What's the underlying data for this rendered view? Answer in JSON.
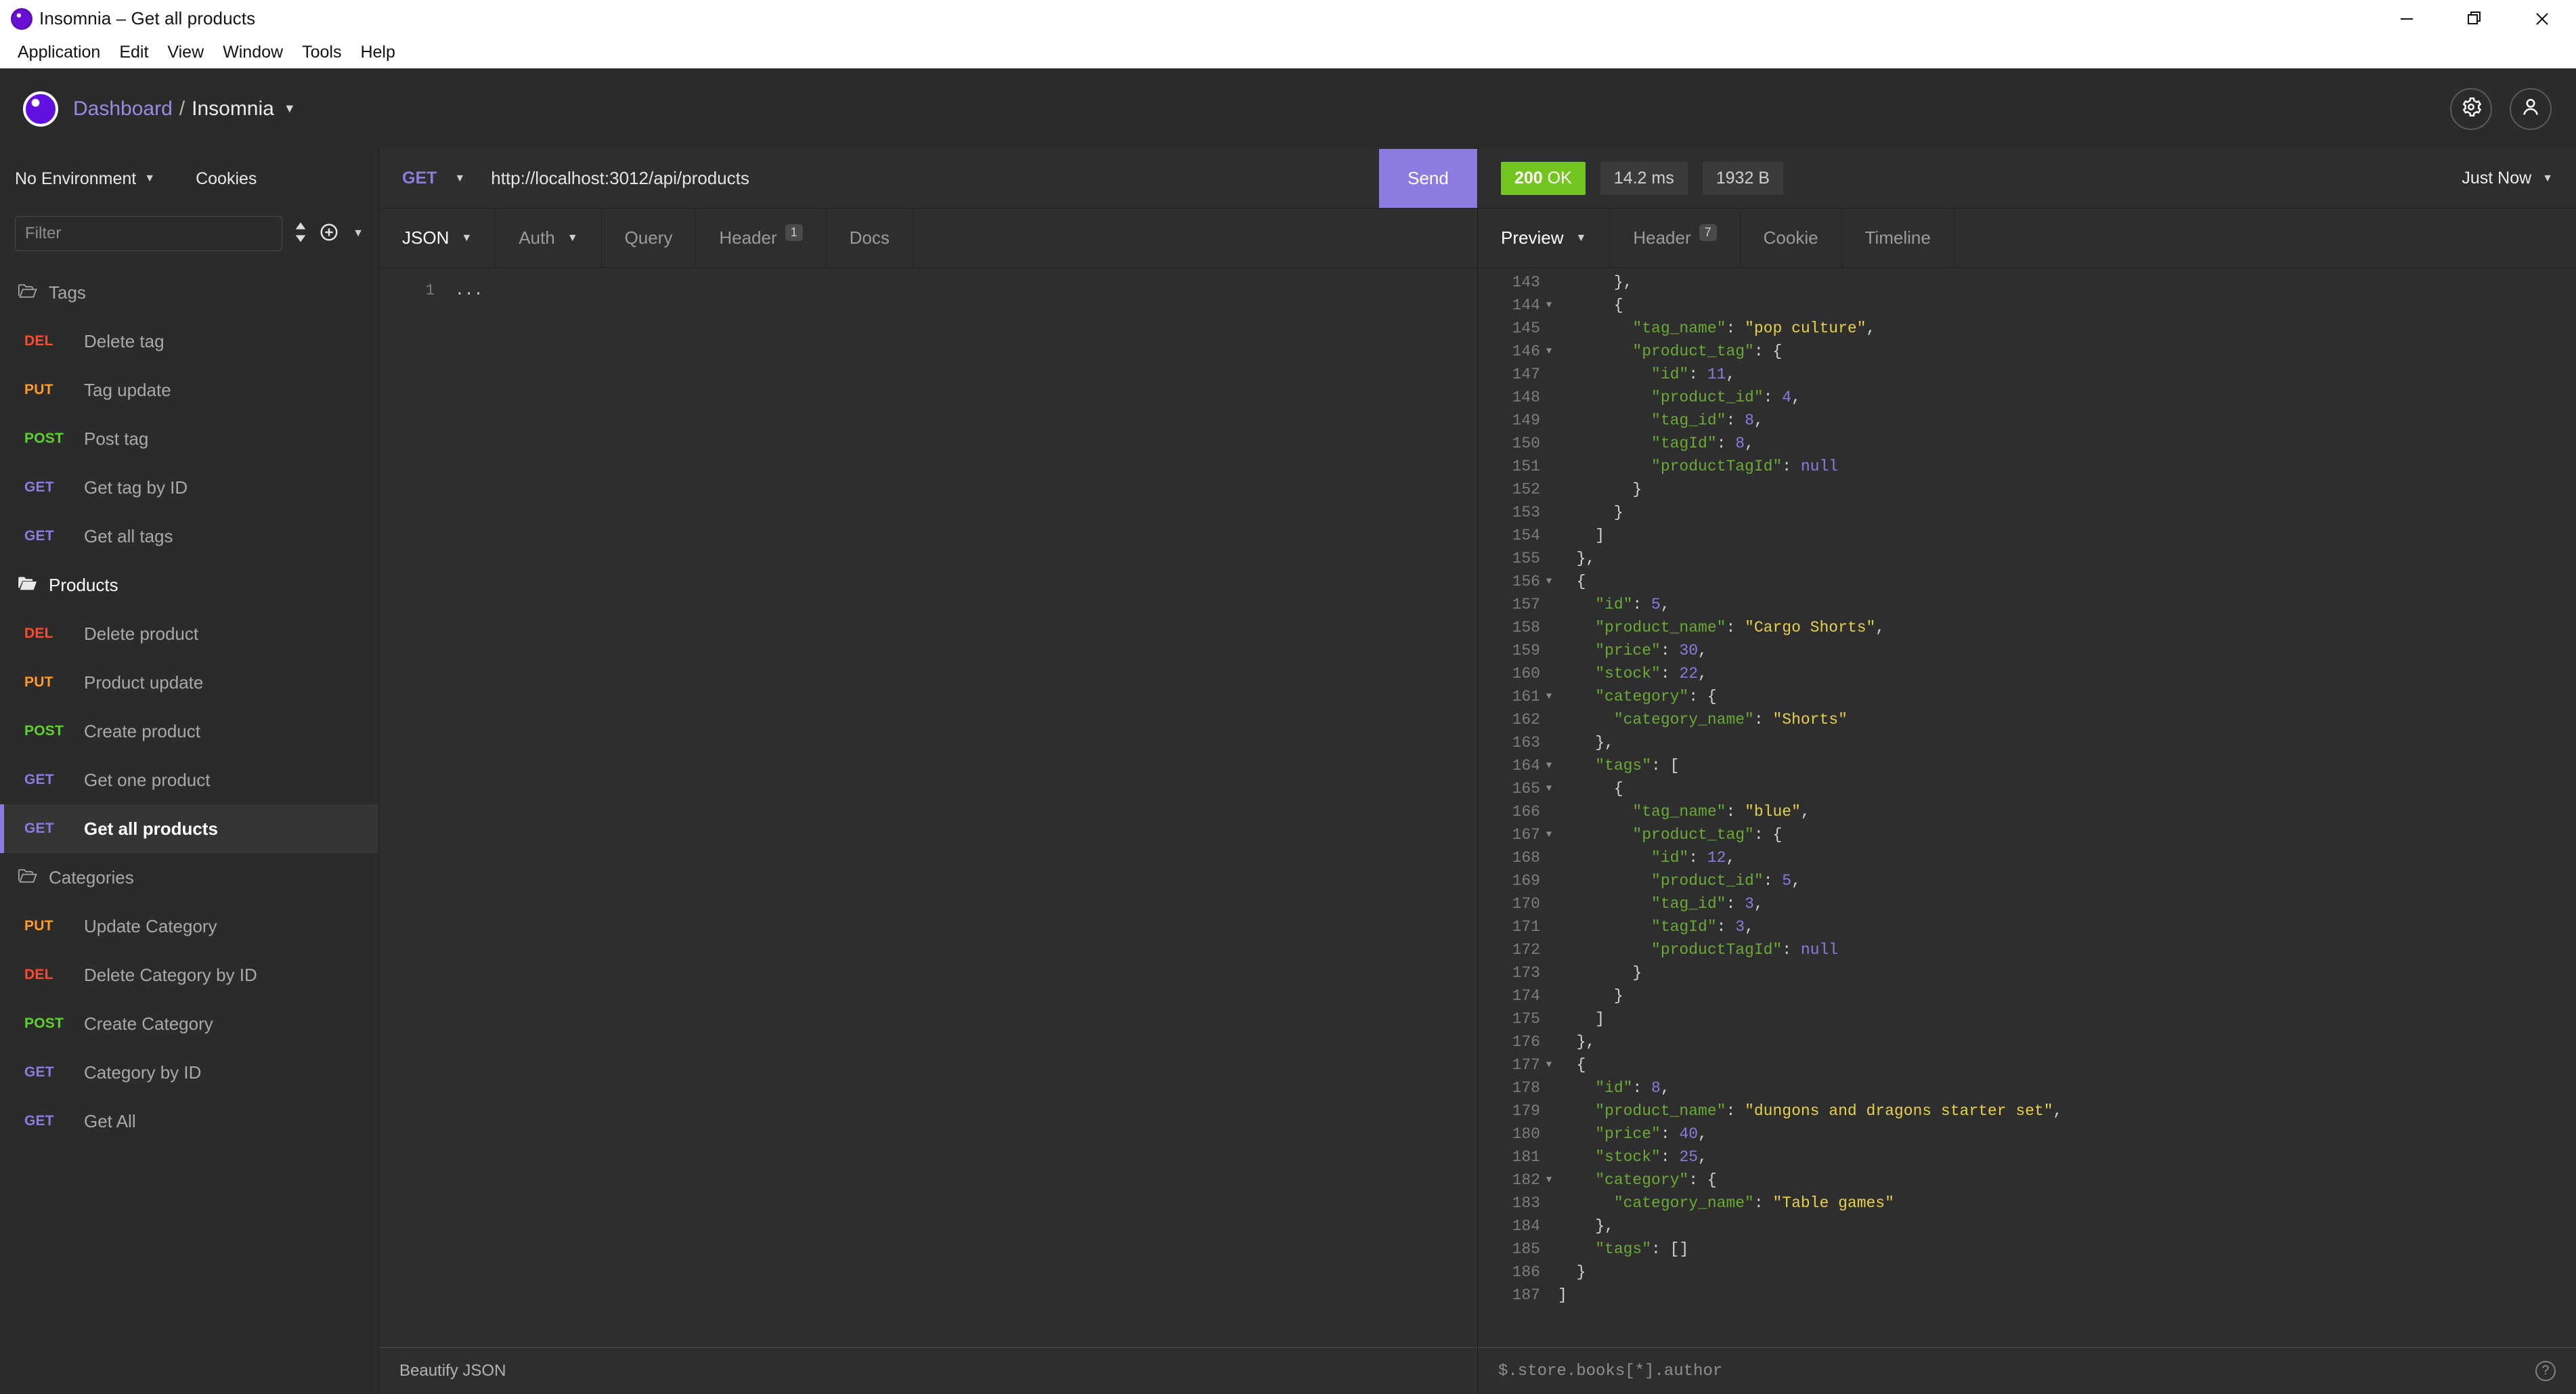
{
  "window": {
    "title": "Insomnia – Get all products",
    "controls": [
      {
        "name": "minimize",
        "glyph": "minimize-icon"
      },
      {
        "name": "maximize",
        "glyph": "restore-icon"
      },
      {
        "name": "close",
        "glyph": "close-icon"
      }
    ]
  },
  "menubar": [
    "Application",
    "Edit",
    "View",
    "Window",
    "Tools",
    "Help"
  ],
  "header": {
    "breadcrumb_root": "Dashboard",
    "breadcrumb_sep": "/",
    "breadcrumb_current": "Insomnia",
    "settings_icon": "gear-icon",
    "account_icon": "account-icon"
  },
  "sidebar": {
    "environment": "No Environment",
    "cookies": "Cookies",
    "filter_placeholder": "Filter",
    "sort_icon": "sort-icon",
    "add_icon": "plus-circle-icon",
    "groups": [
      {
        "name": "Tags",
        "active": false,
        "items": [
          {
            "method": "DEL",
            "name": "Delete tag",
            "selected": false
          },
          {
            "method": "PUT",
            "name": "Tag update",
            "selected": false
          },
          {
            "method": "POST",
            "name": "Post tag",
            "selected": false
          },
          {
            "method": "GET",
            "name": "Get tag by ID",
            "selected": false
          },
          {
            "method": "GET",
            "name": "Get all tags",
            "selected": false
          }
        ]
      },
      {
        "name": "Products",
        "active": true,
        "items": [
          {
            "method": "DEL",
            "name": "Delete product",
            "selected": false
          },
          {
            "method": "PUT",
            "name": "Product update",
            "selected": false
          },
          {
            "method": "POST",
            "name": "Create product",
            "selected": false
          },
          {
            "method": "GET",
            "name": "Get one product",
            "selected": false
          },
          {
            "method": "GET",
            "name": "Get all products",
            "selected": true
          }
        ]
      },
      {
        "name": "Categories",
        "active": false,
        "items": [
          {
            "method": "PUT",
            "name": "Update Category",
            "selected": false
          },
          {
            "method": "DEL",
            "name": "Delete Category by ID",
            "selected": false
          },
          {
            "method": "POST",
            "name": "Create Category",
            "selected": false
          },
          {
            "method": "GET",
            "name": "Category by ID",
            "selected": false
          },
          {
            "method": "GET",
            "name": "Get All",
            "selected": false
          }
        ]
      }
    ],
    "method_colors": {
      "DEL": "#ff4a30",
      "PUT": "#ff9a2e",
      "POST": "#5ed330",
      "GET": "#8b7ce0"
    }
  },
  "request": {
    "method": "GET",
    "url": "http://localhost:3012/api/products",
    "send_label": "Send",
    "tabs": [
      {
        "label": "JSON",
        "active": true,
        "dropdown": true,
        "badge": null
      },
      {
        "label": "Auth",
        "active": false,
        "dropdown": true,
        "badge": null
      },
      {
        "label": "Query",
        "active": false,
        "dropdown": false,
        "badge": null
      },
      {
        "label": "Header",
        "active": false,
        "dropdown": false,
        "badge": "1"
      },
      {
        "label": "Docs",
        "active": false,
        "dropdown": false,
        "badge": null
      }
    ],
    "body_lines": [
      {
        "num": "1",
        "text": "..."
      }
    ],
    "footer_label": "Beautify JSON"
  },
  "response": {
    "status_code": "200",
    "status_text": "OK",
    "time": "14.2 ms",
    "size": "1932 B",
    "timestamp": "Just Now",
    "tabs": [
      {
        "label": "Preview",
        "active": true,
        "dropdown": true,
        "badge": null
      },
      {
        "label": "Header",
        "active": false,
        "dropdown": false,
        "badge": "7"
      },
      {
        "label": "Cookie",
        "active": false,
        "dropdown": false,
        "badge": null
      },
      {
        "label": "Timeline",
        "active": false,
        "dropdown": false,
        "badge": null
      }
    ],
    "filter_placeholder": "$.store.books[*].author",
    "help_icon": "help-circle-icon",
    "accent_colors": {
      "send": "#8b7ce0",
      "status_ok": "#74c520",
      "json_key": "#6aaa35",
      "json_string": "#e6d14a",
      "json_number": "#8b7ce0"
    },
    "json_lines": [
      {
        "num": "143",
        "fold": false,
        "tokens": [
          {
            "t": "p",
            "v": "      },"
          }
        ]
      },
      {
        "num": "144",
        "fold": true,
        "tokens": [
          {
            "t": "p",
            "v": "      {"
          }
        ]
      },
      {
        "num": "145",
        "fold": false,
        "tokens": [
          {
            "t": "k",
            "v": "        \"tag_name\""
          },
          {
            "t": "p",
            "v": ": "
          },
          {
            "t": "s",
            "v": "\"pop culture\""
          },
          {
            "t": "p",
            "v": ","
          }
        ]
      },
      {
        "num": "146",
        "fold": true,
        "tokens": [
          {
            "t": "k",
            "v": "        \"product_tag\""
          },
          {
            "t": "p",
            "v": ": {"
          }
        ]
      },
      {
        "num": "147",
        "fold": false,
        "tokens": [
          {
            "t": "k",
            "v": "          \"id\""
          },
          {
            "t": "p",
            "v": ": "
          },
          {
            "t": "n",
            "v": "11"
          },
          {
            "t": "p",
            "v": ","
          }
        ]
      },
      {
        "num": "148",
        "fold": false,
        "tokens": [
          {
            "t": "k",
            "v": "          \"product_id\""
          },
          {
            "t": "p",
            "v": ": "
          },
          {
            "t": "n",
            "v": "4"
          },
          {
            "t": "p",
            "v": ","
          }
        ]
      },
      {
        "num": "149",
        "fold": false,
        "tokens": [
          {
            "t": "k",
            "v": "          \"tag_id\""
          },
          {
            "t": "p",
            "v": ": "
          },
          {
            "t": "n",
            "v": "8"
          },
          {
            "t": "p",
            "v": ","
          }
        ]
      },
      {
        "num": "150",
        "fold": false,
        "tokens": [
          {
            "t": "k",
            "v": "          \"tagId\""
          },
          {
            "t": "p",
            "v": ": "
          },
          {
            "t": "n",
            "v": "8"
          },
          {
            "t": "p",
            "v": ","
          }
        ]
      },
      {
        "num": "151",
        "fold": false,
        "tokens": [
          {
            "t": "k",
            "v": "          \"productTagId\""
          },
          {
            "t": "p",
            "v": ": "
          },
          {
            "t": "n",
            "v": "null"
          }
        ]
      },
      {
        "num": "152",
        "fold": false,
        "tokens": [
          {
            "t": "p",
            "v": "        }"
          }
        ]
      },
      {
        "num": "153",
        "fold": false,
        "tokens": [
          {
            "t": "p",
            "v": "      }"
          }
        ]
      },
      {
        "num": "154",
        "fold": false,
        "tokens": [
          {
            "t": "p",
            "v": "    ]"
          }
        ]
      },
      {
        "num": "155",
        "fold": false,
        "tokens": [
          {
            "t": "p",
            "v": "  },"
          }
        ]
      },
      {
        "num": "156",
        "fold": true,
        "tokens": [
          {
            "t": "p",
            "v": "  {"
          }
        ]
      },
      {
        "num": "157",
        "fold": false,
        "tokens": [
          {
            "t": "k",
            "v": "    \"id\""
          },
          {
            "t": "p",
            "v": ": "
          },
          {
            "t": "n",
            "v": "5"
          },
          {
            "t": "p",
            "v": ","
          }
        ]
      },
      {
        "num": "158",
        "fold": false,
        "tokens": [
          {
            "t": "k",
            "v": "    \"product_name\""
          },
          {
            "t": "p",
            "v": ": "
          },
          {
            "t": "s",
            "v": "\"Cargo Shorts\""
          },
          {
            "t": "p",
            "v": ","
          }
        ]
      },
      {
        "num": "159",
        "fold": false,
        "tokens": [
          {
            "t": "k",
            "v": "    \"price\""
          },
          {
            "t": "p",
            "v": ": "
          },
          {
            "t": "n",
            "v": "30"
          },
          {
            "t": "p",
            "v": ","
          }
        ]
      },
      {
        "num": "160",
        "fold": false,
        "tokens": [
          {
            "t": "k",
            "v": "    \"stock\""
          },
          {
            "t": "p",
            "v": ": "
          },
          {
            "t": "n",
            "v": "22"
          },
          {
            "t": "p",
            "v": ","
          }
        ]
      },
      {
        "num": "161",
        "fold": true,
        "tokens": [
          {
            "t": "k",
            "v": "    \"category\""
          },
          {
            "t": "p",
            "v": ": {"
          }
        ]
      },
      {
        "num": "162",
        "fold": false,
        "tokens": [
          {
            "t": "k",
            "v": "      \"category_name\""
          },
          {
            "t": "p",
            "v": ": "
          },
          {
            "t": "s",
            "v": "\"Shorts\""
          }
        ]
      },
      {
        "num": "163",
        "fold": false,
        "tokens": [
          {
            "t": "p",
            "v": "    },"
          }
        ]
      },
      {
        "num": "164",
        "fold": true,
        "tokens": [
          {
            "t": "k",
            "v": "    \"tags\""
          },
          {
            "t": "p",
            "v": ": ["
          }
        ]
      },
      {
        "num": "165",
        "fold": true,
        "tokens": [
          {
            "t": "p",
            "v": "      {"
          }
        ]
      },
      {
        "num": "166",
        "fold": false,
        "tokens": [
          {
            "t": "k",
            "v": "        \"tag_name\""
          },
          {
            "t": "p",
            "v": ": "
          },
          {
            "t": "s",
            "v": "\"blue\""
          },
          {
            "t": "p",
            "v": ","
          }
        ]
      },
      {
        "num": "167",
        "fold": true,
        "tokens": [
          {
            "t": "k",
            "v": "        \"product_tag\""
          },
          {
            "t": "p",
            "v": ": {"
          }
        ]
      },
      {
        "num": "168",
        "fold": false,
        "tokens": [
          {
            "t": "k",
            "v": "          \"id\""
          },
          {
            "t": "p",
            "v": ": "
          },
          {
            "t": "n",
            "v": "12"
          },
          {
            "t": "p",
            "v": ","
          }
        ]
      },
      {
        "num": "169",
        "fold": false,
        "tokens": [
          {
            "t": "k",
            "v": "          \"product_id\""
          },
          {
            "t": "p",
            "v": ": "
          },
          {
            "t": "n",
            "v": "5"
          },
          {
            "t": "p",
            "v": ","
          }
        ]
      },
      {
        "num": "170",
        "fold": false,
        "tokens": [
          {
            "t": "k",
            "v": "          \"tag_id\""
          },
          {
            "t": "p",
            "v": ": "
          },
          {
            "t": "n",
            "v": "3"
          },
          {
            "t": "p",
            "v": ","
          }
        ]
      },
      {
        "num": "171",
        "fold": false,
        "tokens": [
          {
            "t": "k",
            "v": "          \"tagId\""
          },
          {
            "t": "p",
            "v": ": "
          },
          {
            "t": "n",
            "v": "3"
          },
          {
            "t": "p",
            "v": ","
          }
        ]
      },
      {
        "num": "172",
        "fold": false,
        "tokens": [
          {
            "t": "k",
            "v": "          \"productTagId\""
          },
          {
            "t": "p",
            "v": ": "
          },
          {
            "t": "n",
            "v": "null"
          }
        ]
      },
      {
        "num": "173",
        "fold": false,
        "tokens": [
          {
            "t": "p",
            "v": "        }"
          }
        ]
      },
      {
        "num": "174",
        "fold": false,
        "tokens": [
          {
            "t": "p",
            "v": "      }"
          }
        ]
      },
      {
        "num": "175",
        "fold": false,
        "tokens": [
          {
            "t": "p",
            "v": "    ]"
          }
        ]
      },
      {
        "num": "176",
        "fold": false,
        "tokens": [
          {
            "t": "p",
            "v": "  },"
          }
        ]
      },
      {
        "num": "177",
        "fold": true,
        "tokens": [
          {
            "t": "p",
            "v": "  {"
          }
        ]
      },
      {
        "num": "178",
        "fold": false,
        "tokens": [
          {
            "t": "k",
            "v": "    \"id\""
          },
          {
            "t": "p",
            "v": ": "
          },
          {
            "t": "n",
            "v": "8"
          },
          {
            "t": "p",
            "v": ","
          }
        ]
      },
      {
        "num": "179",
        "fold": false,
        "tokens": [
          {
            "t": "k",
            "v": "    \"product_name\""
          },
          {
            "t": "p",
            "v": ": "
          },
          {
            "t": "s",
            "v": "\"dungons and dragons starter set\""
          },
          {
            "t": "p",
            "v": ","
          }
        ]
      },
      {
        "num": "180",
        "fold": false,
        "tokens": [
          {
            "t": "k",
            "v": "    \"price\""
          },
          {
            "t": "p",
            "v": ": "
          },
          {
            "t": "n",
            "v": "40"
          },
          {
            "t": "p",
            "v": ","
          }
        ]
      },
      {
        "num": "181",
        "fold": false,
        "tokens": [
          {
            "t": "k",
            "v": "    \"stock\""
          },
          {
            "t": "p",
            "v": ": "
          },
          {
            "t": "n",
            "v": "25"
          },
          {
            "t": "p",
            "v": ","
          }
        ]
      },
      {
        "num": "182",
        "fold": true,
        "tokens": [
          {
            "t": "k",
            "v": "    \"category\""
          },
          {
            "t": "p",
            "v": ": {"
          }
        ]
      },
      {
        "num": "183",
        "fold": false,
        "tokens": [
          {
            "t": "k",
            "v": "      \"category_name\""
          },
          {
            "t": "p",
            "v": ": "
          },
          {
            "t": "s",
            "v": "\"Table games\""
          }
        ]
      },
      {
        "num": "184",
        "fold": false,
        "tokens": [
          {
            "t": "p",
            "v": "    },"
          }
        ]
      },
      {
        "num": "185",
        "fold": false,
        "tokens": [
          {
            "t": "k",
            "v": "    \"tags\""
          },
          {
            "t": "p",
            "v": ": []"
          }
        ]
      },
      {
        "num": "186",
        "fold": false,
        "tokens": [
          {
            "t": "p",
            "v": "  }"
          }
        ]
      },
      {
        "num": "187",
        "fold": false,
        "tokens": [
          {
            "t": "p",
            "v": "]"
          }
        ]
      }
    ]
  }
}
